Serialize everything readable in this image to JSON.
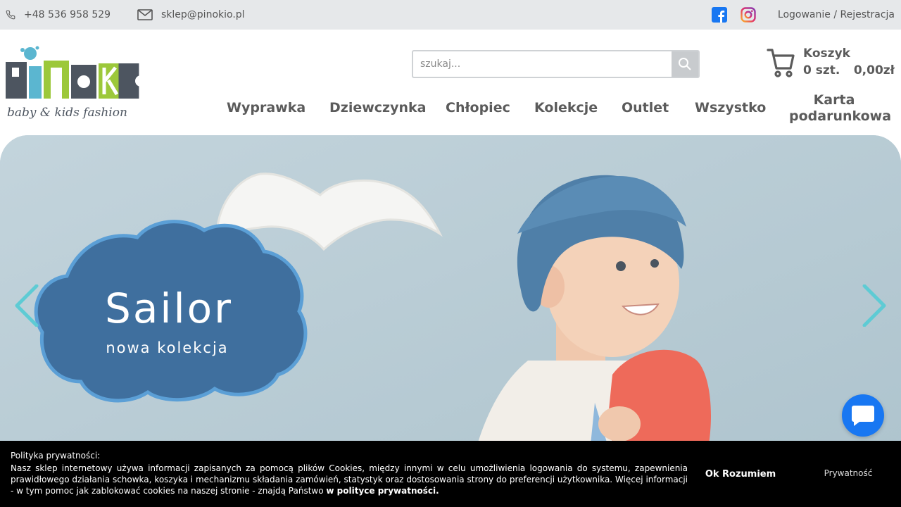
{
  "topbar": {
    "phone": "+48 536 958 529",
    "email": "sklep@pinokio.pl",
    "login": "Logowanie / Rejestracja",
    "facebook_color": "#1877f2"
  },
  "logo": {
    "text": "PINOKIO",
    "tagline": "baby & kids fashion"
  },
  "search": {
    "placeholder": "szukaj..."
  },
  "cart": {
    "title": "Koszyk",
    "qty": "0 szt.",
    "total": "0,00zł"
  },
  "nav": {
    "items": [
      "Wyprawka",
      "Dziewczynka",
      "Chłopiec",
      "Kolekcje",
      "Outlet",
      "Wszystko"
    ],
    "karta_line1": "Karta",
    "karta_line2": "podarunkowa"
  },
  "hero": {
    "title": "Sailor",
    "subtitle": "nowa kolekcja",
    "arrow_color": "#5ecbd4"
  },
  "cookie": {
    "heading": "Polityka prywatności:",
    "text": "Nasz sklep internetowy używa informacji zapisanych za pomocą plików Cookies, między innymi w celu umożliwienia logowania do systemu, zapewnienia prawidłowego działania schowka, koszyka i mechanizmu składania zamówień, statystyk oraz dostosowania strony do preferencji użytkownika. Więcej informacji - w tym pomoc jak zablokować cookies na naszej stronie - znajdą Państwo",
    "link": "w polityce prywatności",
    "link_suffix": ".",
    "ok": "Ok Rozumiem",
    "privacy": "Prywatność"
  }
}
